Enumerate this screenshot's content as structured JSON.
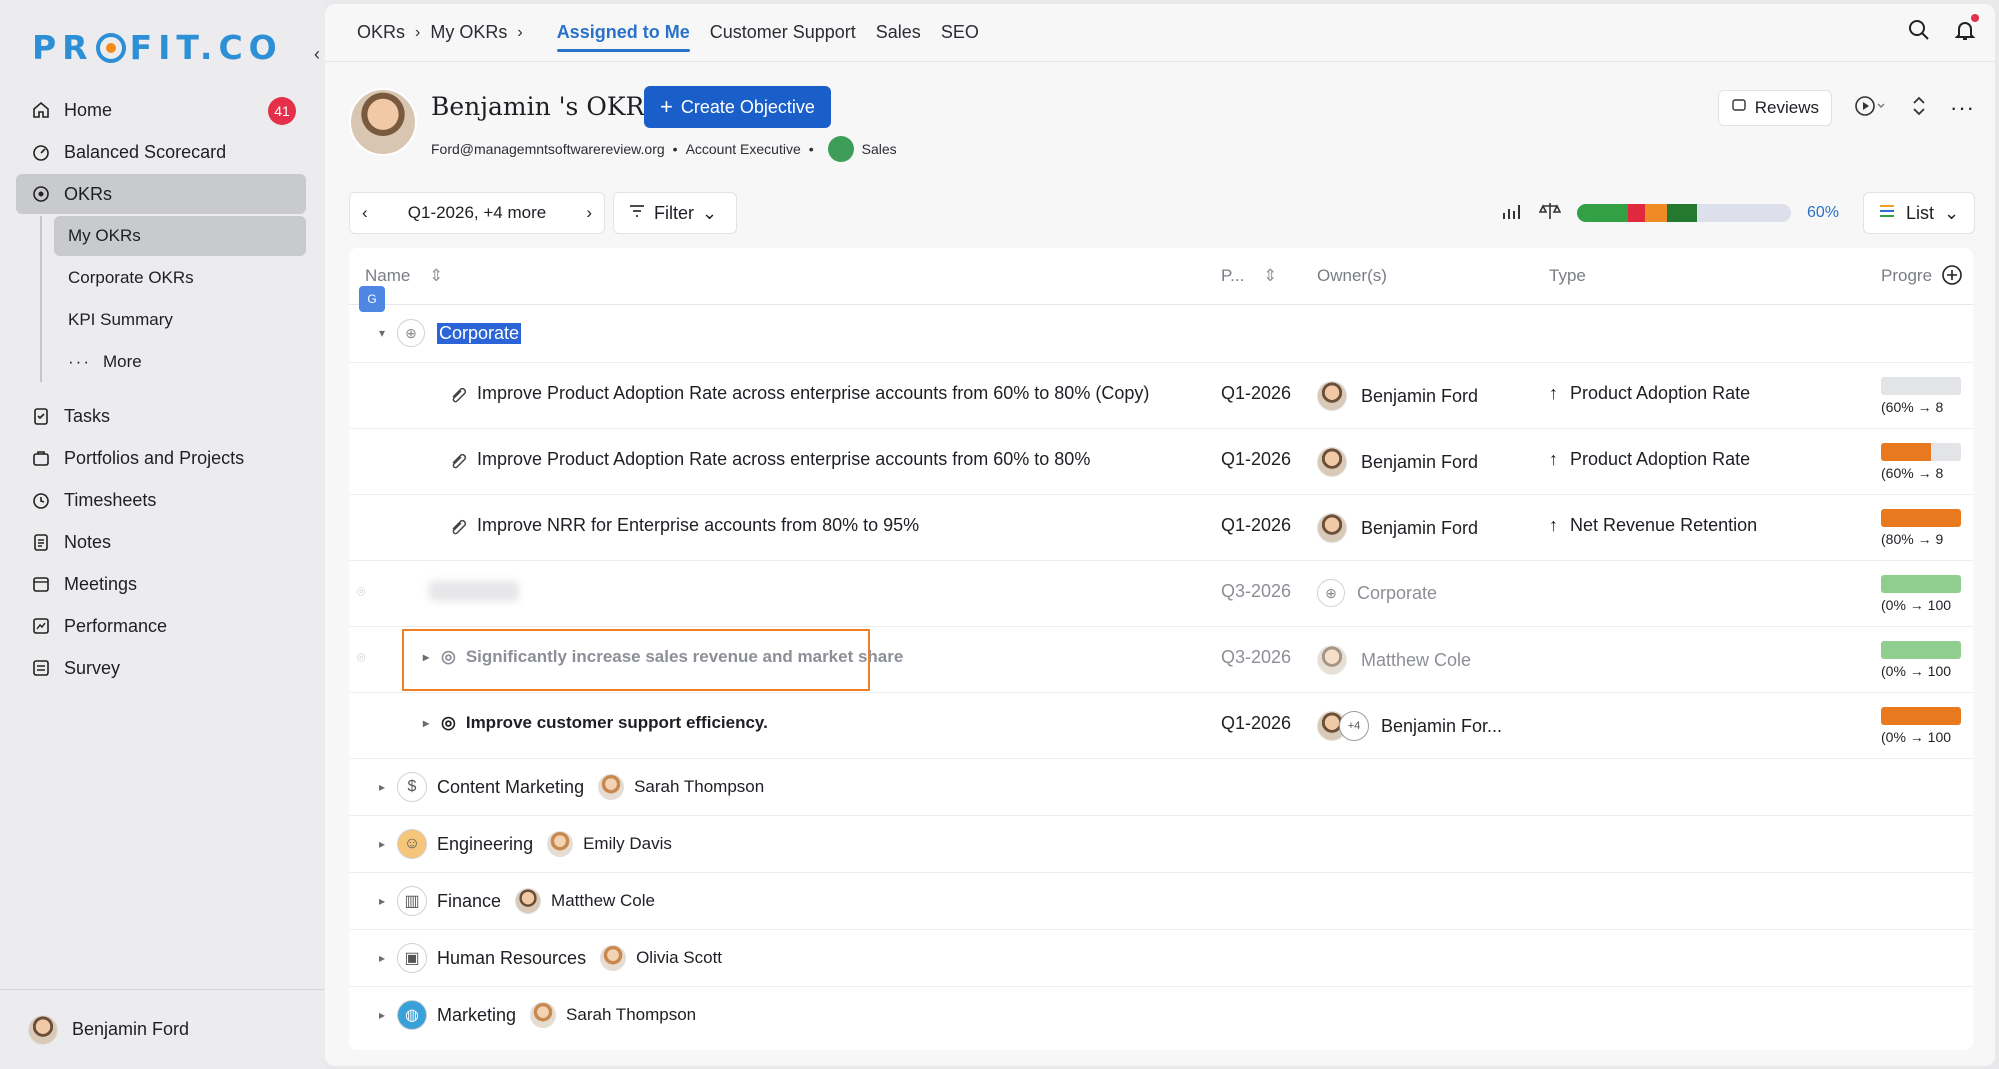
{
  "brand": {
    "name": "PROFIT.CO"
  },
  "sidebar": {
    "items": [
      {
        "label": "Home",
        "badge": "41",
        "icon": "home-icon"
      },
      {
        "label": "Balanced Scorecard",
        "icon": "scorecard-icon"
      },
      {
        "label": "OKRs",
        "icon": "target-icon"
      }
    ],
    "okr_sub": [
      {
        "label": "My OKRs"
      },
      {
        "label": "Corporate OKRs"
      },
      {
        "label": "KPI Summary"
      },
      {
        "label": "More"
      }
    ],
    "items2": [
      {
        "label": "Tasks",
        "icon": "tasks-icon"
      },
      {
        "label": "Portfolios and Projects",
        "icon": "briefcase-icon"
      },
      {
        "label": "Timesheets",
        "icon": "timer-icon"
      },
      {
        "label": "Notes",
        "icon": "notes-icon"
      },
      {
        "label": "Meetings",
        "icon": "calendar-icon"
      },
      {
        "label": "Performance",
        "icon": "chart-icon"
      },
      {
        "label": "Survey",
        "icon": "survey-icon"
      }
    ],
    "user": "Benjamin Ford"
  },
  "breadcrumb": {
    "root": "OKRs",
    "child": "My OKRs"
  },
  "tabs": [
    "Assigned to Me",
    "Customer Support",
    "Sales",
    "SEO"
  ],
  "header": {
    "title": "Benjamin 's OKRs",
    "create_label": "Create Objective",
    "email": "Ford@managemntsoftwarereview.org",
    "role": "Account Executive",
    "dept": "Sales",
    "reviews_label": "Reviews"
  },
  "toolbar": {
    "period": "Q1-2026, +4 more",
    "filter_label": "Filter",
    "progress_pct": "60%",
    "view_label": "List"
  },
  "table": {
    "columns": {
      "name": "Name",
      "period": "P...",
      "owners": "Owner(s)",
      "type": "Type",
      "progress": "Progre"
    },
    "group": "Corporate",
    "rows": [
      {
        "name": "Improve Product Adoption Rate across enterprise accounts from 60% to 80% (Copy)",
        "period": "Q1-2026",
        "owner": "Benjamin Ford",
        "type": "Product Adoption Rate",
        "progress_label": "(60% → 8",
        "fill": 0.0,
        "color": "#e0e1e4"
      },
      {
        "name": "Improve Product Adoption Rate across enterprise accounts from 60% to 80%",
        "period": "Q1-2026",
        "owner": "Benjamin Ford",
        "type": "Product Adoption Rate",
        "progress_label": "(60% → 8",
        "fill": 0.62,
        "color": "#e8791f"
      },
      {
        "name": "Improve NRR for Enterprise accounts from 80% to 95%",
        "period": "Q1-2026",
        "owner": "Benjamin Ford",
        "type": "Net Revenue Retention",
        "progress_label": "(80% → 9",
        "fill": 1.0,
        "color": "#e8791f"
      },
      {
        "name": "",
        "period": "Q3-2026",
        "owner": "Corporate",
        "type": "",
        "progress_label": "(0% → 100",
        "fill": 1.0,
        "color": "#8fce8f"
      },
      {
        "name": "Significantly increase sales revenue and market share",
        "period": "Q3-2026",
        "owner": "Matthew Cole",
        "type": "",
        "progress_label": "(0% → 100",
        "fill": 1.0,
        "color": "#8fce8f"
      },
      {
        "name": "Improve customer support efficiency.",
        "period": "Q1-2026",
        "owner": "Benjamin For...",
        "owner_more": "+4",
        "type": "",
        "progress_label": "(0% → 100",
        "fill": 1.0,
        "color": "#e8791f"
      }
    ],
    "groups": [
      {
        "name": "Content Marketing",
        "lead": "Sarah Thompson",
        "icon": "dollar-icon"
      },
      {
        "name": "Engineering",
        "lead": "Emily Davis",
        "icon": "team-icon"
      },
      {
        "name": "Finance",
        "lead": "Matthew Cole",
        "icon": "finance-chart-icon"
      },
      {
        "name": "Human Resources",
        "lead": "Olivia Scott",
        "icon": "id-card-icon"
      },
      {
        "name": "Marketing",
        "lead": "Sarah Thompson",
        "icon": "globe-icon"
      }
    ]
  },
  "colors": {
    "accent": "#2a72c9",
    "create_btn": "#1a5fc9",
    "badge": "#e5304b",
    "highlight_box": "#ef7f26"
  }
}
